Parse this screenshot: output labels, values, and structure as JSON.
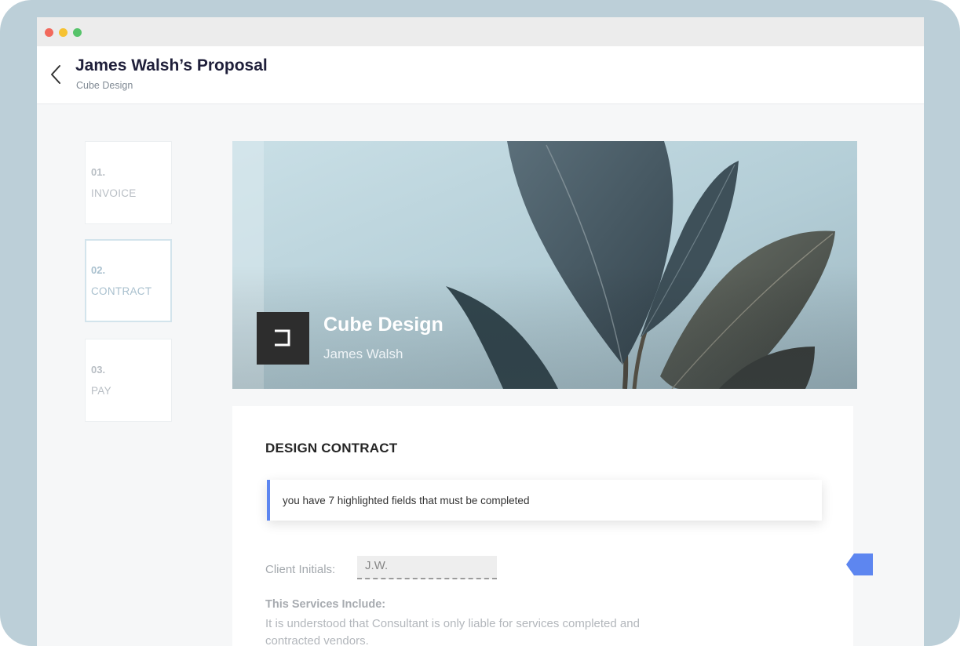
{
  "header": {
    "title": "James Walsh’s Proposal",
    "subtitle": "Cube Design"
  },
  "steps": [
    {
      "number": "01.",
      "label": "INVOICE"
    },
    {
      "number": "02.",
      "label": "CONTRACT"
    },
    {
      "number": "03.",
      "label": "PAY"
    }
  ],
  "hero": {
    "company": "Cube Design",
    "client": "James Walsh"
  },
  "contract": {
    "title": "DESIGN CONTRACT",
    "notice": "you have 7 highlighted fields that must be completed",
    "initials_label": "Client Initials:",
    "initials_value": "J.W.",
    "services_title": "This Services Include:",
    "services_text": "It is understood that Consultant is only liable for services completed and contracted vendors."
  },
  "colors": {
    "accent": "#5d86f0",
    "background": "#bccfd8"
  }
}
